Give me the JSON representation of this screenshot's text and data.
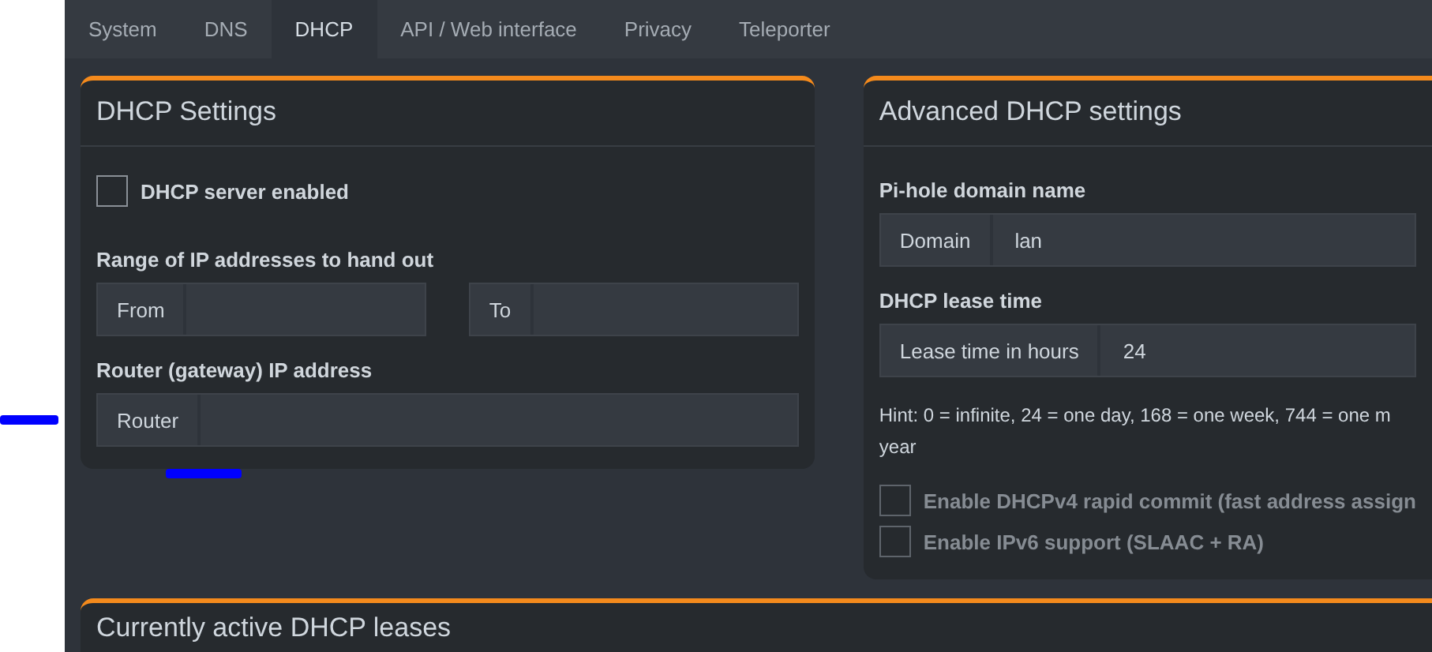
{
  "tabs": [
    {
      "label": "System",
      "selected": false
    },
    {
      "label": "DNS",
      "selected": false
    },
    {
      "label": "DHCP",
      "selected": true
    },
    {
      "label": "API / Web interface",
      "selected": false
    },
    {
      "label": "Privacy",
      "selected": false
    },
    {
      "label": "Teleporter",
      "selected": false
    }
  ],
  "dhcp_settings": {
    "title": "DHCP Settings",
    "server_enabled": {
      "label": "DHCP server enabled",
      "checked": false
    },
    "range": {
      "label": "Range of IP addresses to hand out",
      "from": {
        "addon": "From"
      },
      "to": {
        "addon": "To"
      }
    },
    "router": {
      "label": "Router (gateway) IP address",
      "addon": "Router"
    }
  },
  "advanced": {
    "title": "Advanced DHCP settings",
    "domain": {
      "label": "Pi-hole domain name",
      "addon": "Domain",
      "value": "lan"
    },
    "lease": {
      "label": "DHCP lease time",
      "addon": "Lease time in hours",
      "value": "24"
    },
    "hint": [
      "Hint: 0 = infinite, 24 = one day, 168 = one week, 744 = one m",
      "year"
    ],
    "options": [
      {
        "label": "Enable DHCPv4 rapid commit (fast address assign",
        "checked": false,
        "disabled": true
      },
      {
        "label": "Enable IPv6 support (SLAAC + RA)",
        "checked": false,
        "disabled": true
      }
    ]
  },
  "leases": {
    "title": "Currently active DHCP leases"
  }
}
